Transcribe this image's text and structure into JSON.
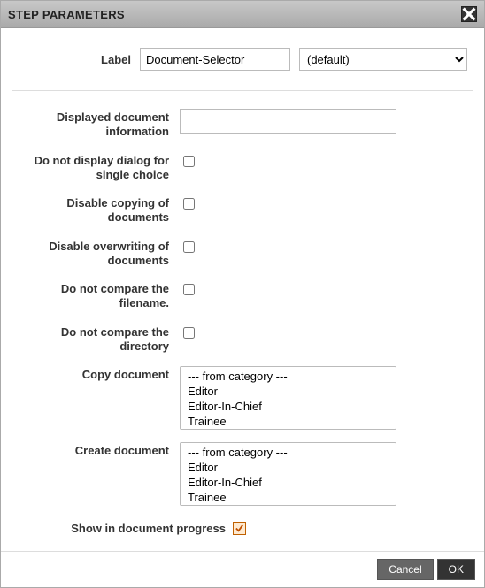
{
  "title": "STEP PARAMETERS",
  "top": {
    "label_text": "Label",
    "label_value": "Document-Selector",
    "preset_selected": "(default)"
  },
  "fields": {
    "displayed_info_label": "Displayed document information",
    "displayed_info_value": "",
    "no_dialog_single_label": "Do not display dialog for single choice",
    "disable_copy_label": "Disable copying of documents",
    "disable_overwrite_label": "Disable overwriting of documents",
    "no_compare_filename_label": "Do not compare the filename.",
    "no_compare_directory_label": "Do not compare the directory",
    "copy_doc_label": "Copy document",
    "create_doc_label": "Create document"
  },
  "category_options": {
    "header": "--- from category ---",
    "opt1": "Editor",
    "opt2": "Editor-In-Chief",
    "opt3": "Trainee"
  },
  "progress": {
    "label": "Show in document progress",
    "checked": true
  },
  "buttons": {
    "cancel": "Cancel",
    "ok": "OK"
  }
}
